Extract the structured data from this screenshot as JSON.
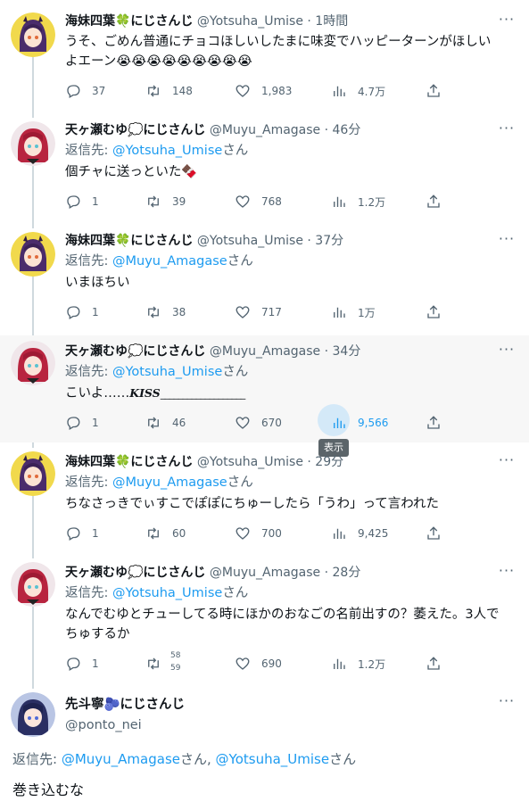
{
  "colors": {
    "accent": "#1d9bf0",
    "muted": "#536471",
    "text": "#0f1419",
    "highlight_bg": "#f7f7f7"
  },
  "tweets": [
    {
      "name": "海妹四葉🍀にじさんじ",
      "meta": "@Yotsuha_Umise · 1時間",
      "reply_label": "",
      "reply_to": "",
      "reply_suffix": "",
      "text_line1": "うそ、ごめん普通にチョコほしいしたまに味変でハッピーターンがほしい",
      "text_line2": "よエーン😭😭😭😭😭😭😭😭😭",
      "replies": "37",
      "retweets": "148",
      "likes": "1,983",
      "views": "4.7万"
    },
    {
      "name": "天ヶ瀬むゆ💭にじさんじ",
      "meta": "@Muyu_Amagase · 46分",
      "reply_label": "返信先: ",
      "reply_to": "@Yotsuha_Umise",
      "reply_suffix": "さん",
      "text": "個チャに送っといた🍫",
      "replies": "1",
      "retweets": "39",
      "likes": "768",
      "views": "1.2万"
    },
    {
      "name": "海妹四葉🍀にじさんじ",
      "meta": "@Yotsuha_Umise · 37分",
      "reply_label": "返信先: ",
      "reply_to": "@Muyu_Amagase",
      "reply_suffix": "さん",
      "text": "いまほちい",
      "replies": "1",
      "retweets": "38",
      "likes": "717",
      "views": "1万"
    },
    {
      "name": "天ヶ瀬むゆ💭にじさんじ",
      "meta": "@Muyu_Amagase · 34分",
      "reply_label": "返信先: ",
      "reply_to": "@Yotsuha_Umise",
      "reply_suffix": "さん",
      "text_prefix": "こいよ……",
      "text_kiss": "KISS",
      "text_line": "___________________",
      "replies": "1",
      "retweets": "46",
      "likes": "670",
      "views": "9,566",
      "tooltip": "表示"
    },
    {
      "name": "海妹四葉🍀にじさんじ",
      "meta": "@Yotsuha_Umise · 29分",
      "reply_label": "返信先: ",
      "reply_to": "@Muyu_Amagase",
      "reply_suffix": "さん",
      "text": "ちなさっきでぃすこでぽぽにちゅーしたら「うわ」って言われた",
      "replies": "1",
      "retweets": "60",
      "likes": "700",
      "views": "9,425"
    },
    {
      "name": "天ヶ瀬むゆ💭にじさんじ",
      "meta": "@Muyu_Amagase · 28分",
      "reply_label": "返信先: ",
      "reply_to": "@Yotsuha_Umise",
      "reply_suffix": "さん",
      "text_line1": "なんでむゆとチューしてる時にほかのおなごの名前出すの？萎えた。3人で",
      "text_line2": "ちゅするか",
      "replies": "1",
      "retweets_top": "58",
      "retweets_bottom": "59",
      "likes": "690",
      "views": "1.2万"
    }
  ],
  "main_tweet": {
    "name": "先斗寧🫐にじさんじ",
    "handle": "@ponto_nei",
    "reply_label": "返信先: ",
    "reply_to_1": "@Muyu_Amagase",
    "reply_mid": "さん, ",
    "reply_to_2": "@Yotsuha_Umise",
    "reply_suffix": "さん",
    "text": "巻き込むな"
  }
}
